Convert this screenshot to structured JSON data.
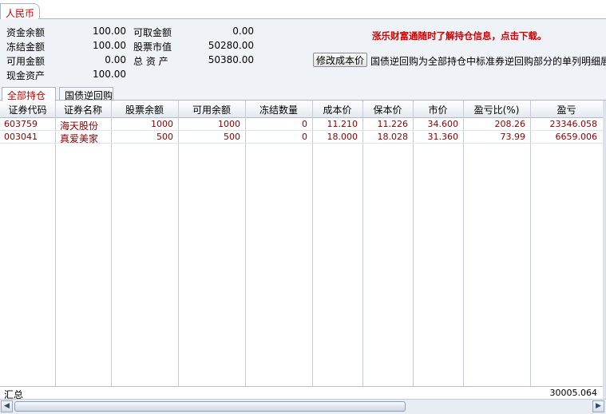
{
  "currency_tab": "人民币",
  "summary": {
    "fund_balance_label": "资金余额",
    "fund_balance": "100.00",
    "frozen_amount_label": "冻结金额",
    "frozen_amount": "100.00",
    "available_amount_label": "可用金额",
    "available_amount": "0.00",
    "cash_assets_label": "现金资产",
    "cash_assets": "100.00",
    "withdrawable_label": "可取金额",
    "withdrawable": "0.00",
    "stock_value_label": "股票市值",
    "stock_value": "50280.00",
    "total_assets_label": "总 资 产",
    "total_assets": "50380.00"
  },
  "notice": "涨乐财富通随时了解持仓信息，点击下载。",
  "edit_cost_button": "修改成本价",
  "repo_note": "国债逆回购为全部持仓中标准券逆回购部分的单列明细展示",
  "tabs": [
    "全部持仓",
    "国债逆回购"
  ],
  "columns": [
    "证券代码",
    "证券名称",
    "股票余额",
    "可用余额",
    "冻结数量",
    "成本价",
    "保本价",
    "市价",
    "盈亏比(%)",
    "盈亏"
  ],
  "rows": [
    [
      "603759",
      "海天股份",
      "1000",
      "1000",
      "0",
      "11.210",
      "11.226",
      "34.600",
      "208.26",
      "23346.058"
    ],
    [
      "003041",
      "真爱美家",
      "500",
      "500",
      "0",
      "18.000",
      "18.028",
      "31.360",
      "73.99",
      "6659.006"
    ]
  ],
  "total": {
    "label": "汇总",
    "pnl": "30005.064"
  },
  "colors": {
    "accent_red": "#c00000",
    "panel_bg": "#eff3f8",
    "row_text": "#8b0000"
  }
}
